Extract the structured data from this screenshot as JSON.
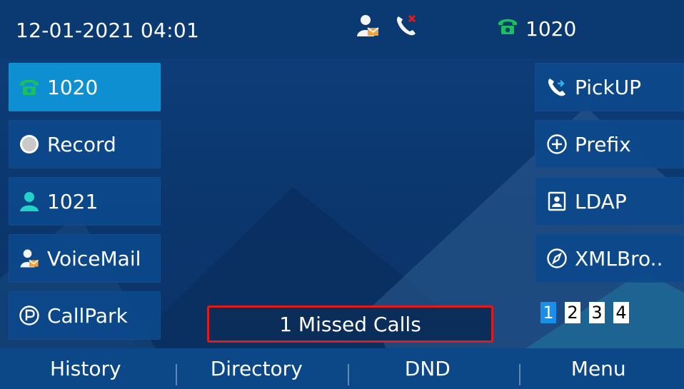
{
  "status_bar": {
    "datetime": "12-01-2021 04:01",
    "icons": [
      "voicemail-user-icon",
      "missed-call-icon"
    ],
    "line_label": "1020",
    "line_icon": "phone-icon"
  },
  "left_keys": [
    {
      "label": "1020",
      "icon": "phone-icon",
      "active": true
    },
    {
      "label": "Record",
      "icon": "record-icon"
    },
    {
      "label": "1021",
      "icon": "contact-icon"
    },
    {
      "label": "VoiceMail",
      "icon": "voicemail-user-icon"
    },
    {
      "label": "CallPark",
      "icon": "park-icon"
    }
  ],
  "right_keys": [
    {
      "label": "PickUP",
      "icon": "pickup-icon"
    },
    {
      "label": "Prefix",
      "icon": "plus-circle-icon"
    },
    {
      "label": "LDAP",
      "icon": "address-book-icon"
    },
    {
      "label": "XMLBro..",
      "icon": "compass-icon"
    }
  ],
  "pages": [
    "1",
    "2",
    "3",
    "4"
  ],
  "current_page": "1",
  "notification": "1 Missed Calls",
  "softkeys": [
    "History",
    "Directory",
    "DND",
    "Menu"
  ],
  "colors": {
    "accent_active": "#0e8fd1",
    "phone_green": "#19c15a",
    "contact_teal": "#22d3c8",
    "missed_red": "#e01b1b",
    "voicemail_orange": "#f0a33a"
  }
}
